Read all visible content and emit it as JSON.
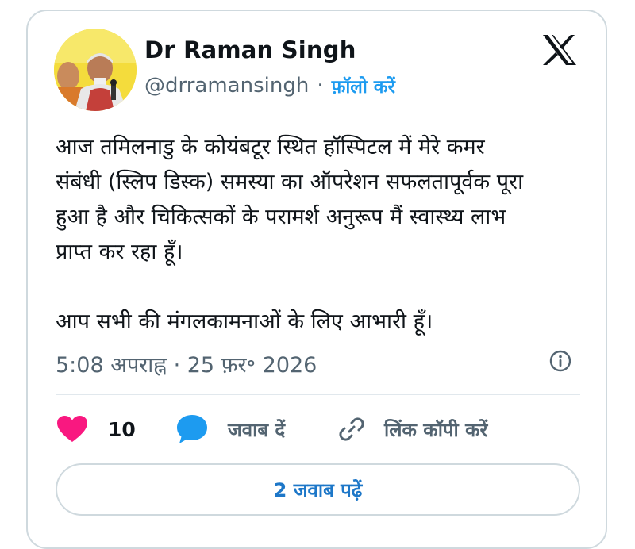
{
  "author": {
    "name": "Dr Raman Singh",
    "handle": "@drramansingh",
    "separator": "·",
    "follow_label": "फ़ॉलो करें"
  },
  "tweet": {
    "lines": [
      "आज तमिलनाडु के कोयंबटूर स्थित हॉस्पिटल में मेरे कमर",
      "संबंधी (स्लिप डिस्क) समस्या का ऑपरेशन सफलतापूर्वक पूरा",
      "हुआ है और चिकित्सकों के परामर्श अनुरूप मैं स्वास्थ्य लाभ",
      "प्राप्त कर रहा हूँ।"
    ],
    "closing": "आप सभी की मंगलकामनाओं के लिए आभारी हूँ।",
    "timestamp": "5:08 अपराह्न · 25 फ़र॰ 2026"
  },
  "actions": {
    "like_count": "10",
    "reply_label": "जवाब दें",
    "copy_link_label": "लिंक कॉपी करें"
  },
  "read_replies_label": "2 जवाब पढ़ें",
  "colors": {
    "accent": "#1d9bf0",
    "like": "#f91880",
    "reply_icon": "#1d9bf0",
    "muted": "#536471",
    "border": "#cfd9de"
  },
  "icons": {
    "platform": "x-logo-icon",
    "info": "info-icon",
    "like": "heart-icon",
    "reply": "speech-bubble-icon",
    "copy_link": "link-icon"
  }
}
